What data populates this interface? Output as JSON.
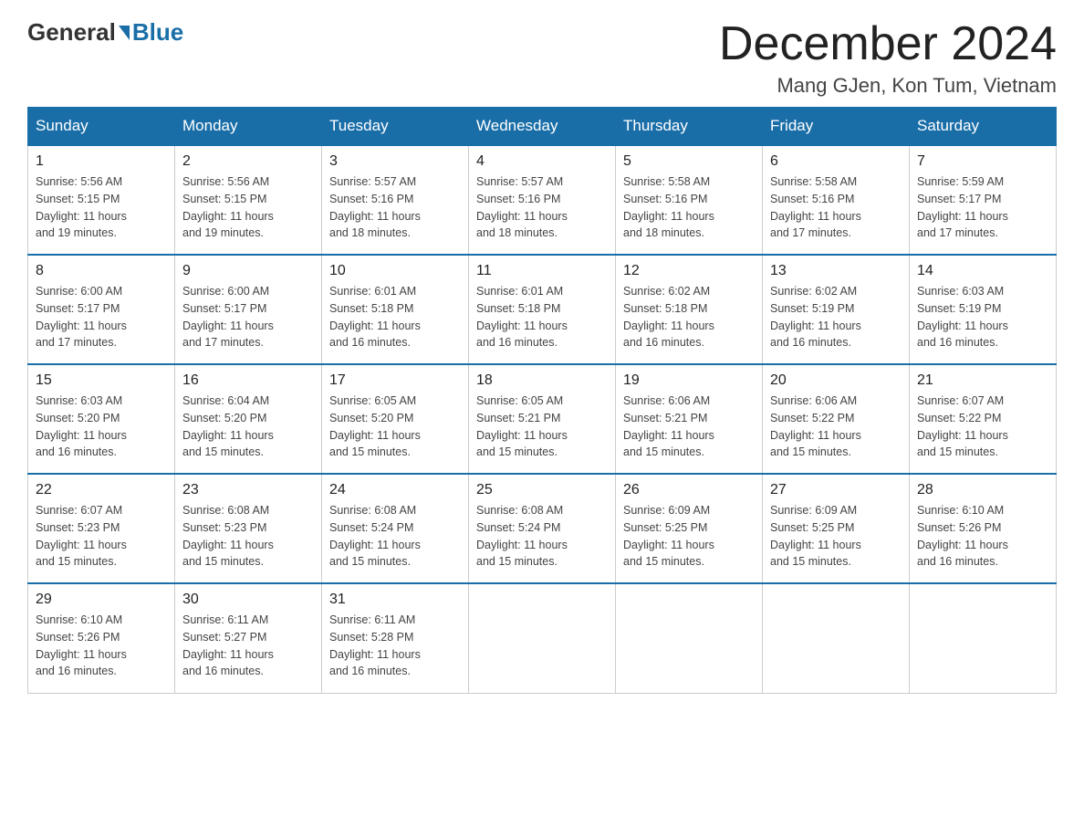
{
  "header": {
    "logo_general": "General",
    "logo_blue": "Blue",
    "month_title": "December 2024",
    "location": "Mang GJen, Kon Tum, Vietnam"
  },
  "days_of_week": [
    "Sunday",
    "Monday",
    "Tuesday",
    "Wednesday",
    "Thursday",
    "Friday",
    "Saturday"
  ],
  "weeks": [
    [
      {
        "day": "1",
        "sunrise": "5:56 AM",
        "sunset": "5:15 PM",
        "daylight": "11 hours and 19 minutes."
      },
      {
        "day": "2",
        "sunrise": "5:56 AM",
        "sunset": "5:15 PM",
        "daylight": "11 hours and 19 minutes."
      },
      {
        "day": "3",
        "sunrise": "5:57 AM",
        "sunset": "5:16 PM",
        "daylight": "11 hours and 18 minutes."
      },
      {
        "day": "4",
        "sunrise": "5:57 AM",
        "sunset": "5:16 PM",
        "daylight": "11 hours and 18 minutes."
      },
      {
        "day": "5",
        "sunrise": "5:58 AM",
        "sunset": "5:16 PM",
        "daylight": "11 hours and 18 minutes."
      },
      {
        "day": "6",
        "sunrise": "5:58 AM",
        "sunset": "5:16 PM",
        "daylight": "11 hours and 17 minutes."
      },
      {
        "day": "7",
        "sunrise": "5:59 AM",
        "sunset": "5:17 PM",
        "daylight": "11 hours and 17 minutes."
      }
    ],
    [
      {
        "day": "8",
        "sunrise": "6:00 AM",
        "sunset": "5:17 PM",
        "daylight": "11 hours and 17 minutes."
      },
      {
        "day": "9",
        "sunrise": "6:00 AM",
        "sunset": "5:17 PM",
        "daylight": "11 hours and 17 minutes."
      },
      {
        "day": "10",
        "sunrise": "6:01 AM",
        "sunset": "5:18 PM",
        "daylight": "11 hours and 16 minutes."
      },
      {
        "day": "11",
        "sunrise": "6:01 AM",
        "sunset": "5:18 PM",
        "daylight": "11 hours and 16 minutes."
      },
      {
        "day": "12",
        "sunrise": "6:02 AM",
        "sunset": "5:18 PM",
        "daylight": "11 hours and 16 minutes."
      },
      {
        "day": "13",
        "sunrise": "6:02 AM",
        "sunset": "5:19 PM",
        "daylight": "11 hours and 16 minutes."
      },
      {
        "day": "14",
        "sunrise": "6:03 AM",
        "sunset": "5:19 PM",
        "daylight": "11 hours and 16 minutes."
      }
    ],
    [
      {
        "day": "15",
        "sunrise": "6:03 AM",
        "sunset": "5:20 PM",
        "daylight": "11 hours and 16 minutes."
      },
      {
        "day": "16",
        "sunrise": "6:04 AM",
        "sunset": "5:20 PM",
        "daylight": "11 hours and 15 minutes."
      },
      {
        "day": "17",
        "sunrise": "6:05 AM",
        "sunset": "5:20 PM",
        "daylight": "11 hours and 15 minutes."
      },
      {
        "day": "18",
        "sunrise": "6:05 AM",
        "sunset": "5:21 PM",
        "daylight": "11 hours and 15 minutes."
      },
      {
        "day": "19",
        "sunrise": "6:06 AM",
        "sunset": "5:21 PM",
        "daylight": "11 hours and 15 minutes."
      },
      {
        "day": "20",
        "sunrise": "6:06 AM",
        "sunset": "5:22 PM",
        "daylight": "11 hours and 15 minutes."
      },
      {
        "day": "21",
        "sunrise": "6:07 AM",
        "sunset": "5:22 PM",
        "daylight": "11 hours and 15 minutes."
      }
    ],
    [
      {
        "day": "22",
        "sunrise": "6:07 AM",
        "sunset": "5:23 PM",
        "daylight": "11 hours and 15 minutes."
      },
      {
        "day": "23",
        "sunrise": "6:08 AM",
        "sunset": "5:23 PM",
        "daylight": "11 hours and 15 minutes."
      },
      {
        "day": "24",
        "sunrise": "6:08 AM",
        "sunset": "5:24 PM",
        "daylight": "11 hours and 15 minutes."
      },
      {
        "day": "25",
        "sunrise": "6:08 AM",
        "sunset": "5:24 PM",
        "daylight": "11 hours and 15 minutes."
      },
      {
        "day": "26",
        "sunrise": "6:09 AM",
        "sunset": "5:25 PM",
        "daylight": "11 hours and 15 minutes."
      },
      {
        "day": "27",
        "sunrise": "6:09 AM",
        "sunset": "5:25 PM",
        "daylight": "11 hours and 15 minutes."
      },
      {
        "day": "28",
        "sunrise": "6:10 AM",
        "sunset": "5:26 PM",
        "daylight": "11 hours and 16 minutes."
      }
    ],
    [
      {
        "day": "29",
        "sunrise": "6:10 AM",
        "sunset": "5:26 PM",
        "daylight": "11 hours and 16 minutes."
      },
      {
        "day": "30",
        "sunrise": "6:11 AM",
        "sunset": "5:27 PM",
        "daylight": "11 hours and 16 minutes."
      },
      {
        "day": "31",
        "sunrise": "6:11 AM",
        "sunset": "5:28 PM",
        "daylight": "11 hours and 16 minutes."
      },
      null,
      null,
      null,
      null
    ]
  ],
  "labels": {
    "sunrise": "Sunrise:",
    "sunset": "Sunset:",
    "daylight": "Daylight:"
  }
}
